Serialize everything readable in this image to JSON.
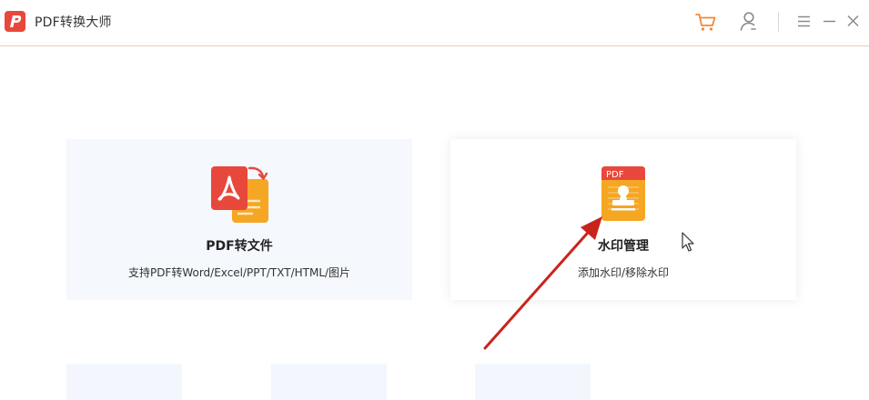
{
  "app": {
    "title": "PDF转换大师"
  },
  "titlebar": {
    "icons": [
      "cart-icon",
      "user-icon",
      "menu-icon",
      "minimize-icon",
      "close-icon"
    ]
  },
  "cards": [
    {
      "title": "PDF转文件",
      "description": "支持PDF转Word/Excel/PPT/TXT/HTML/图片",
      "icon": "pdf-convert-icon"
    },
    {
      "title": "水印管理",
      "description": "添加水印/移除水印",
      "icon": "watermark-icon",
      "icon_label": "PDF"
    }
  ],
  "colors": {
    "brand": "#e8483b",
    "accent_orange": "#f5a623",
    "annotation_arrow": "#c8241c"
  }
}
